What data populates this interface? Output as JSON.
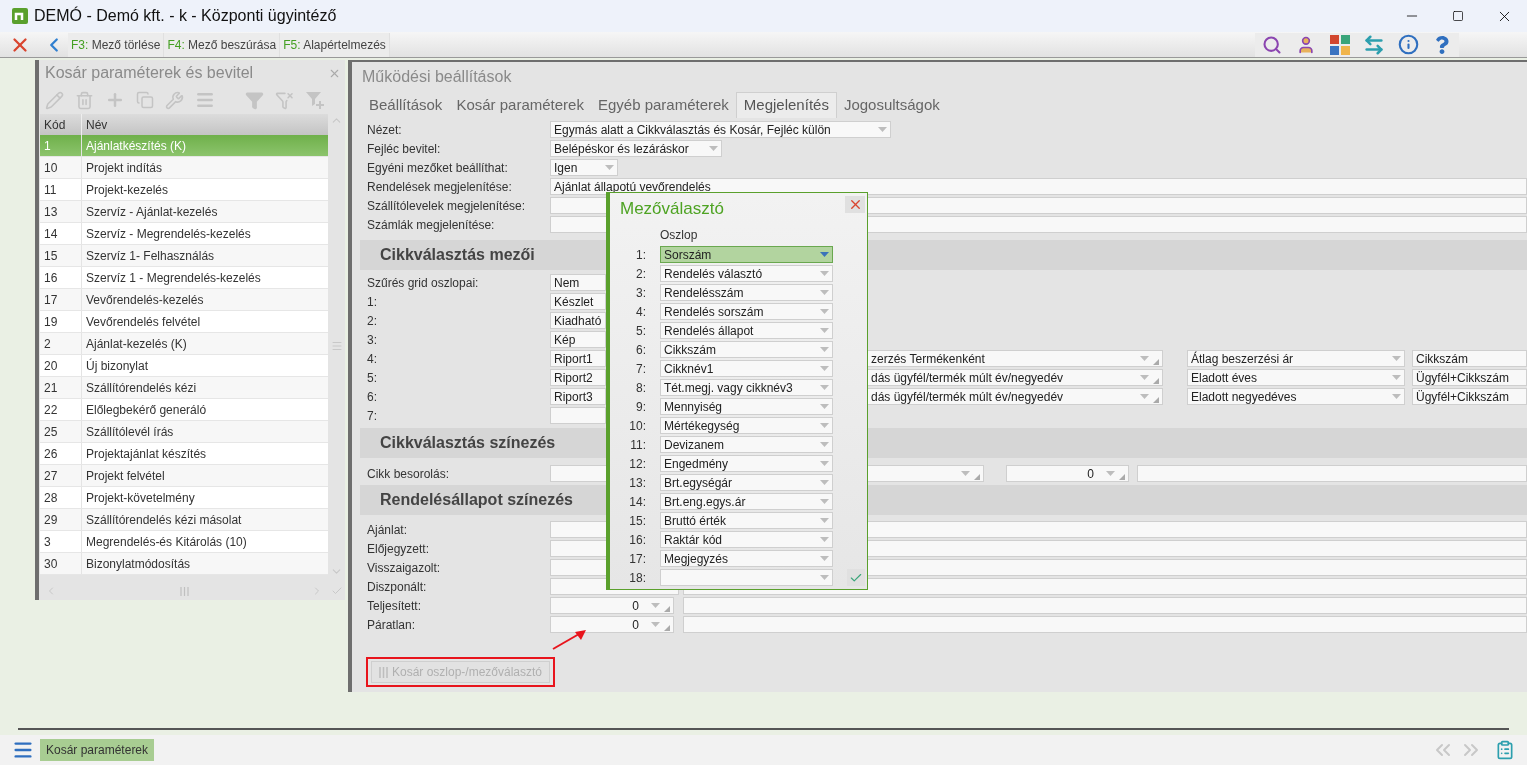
{
  "window": {
    "title": "DEMÓ - Demó kft. - k - Központi ügyintéző"
  },
  "toolbar": {
    "keys": [
      {
        "key": "F3:",
        "label": "Mező törlése"
      },
      {
        "key": "F4:",
        "label": "Mező beszúrása"
      },
      {
        "key": "F5:",
        "label": "Alapértelmezés"
      }
    ]
  },
  "left_panel": {
    "title": "Kosár paraméterek és bevitel",
    "columns": [
      "Kód",
      "Név"
    ],
    "rows": [
      {
        "code": "1",
        "name": "Ajánlatkészítés (K)",
        "selected": true
      },
      {
        "code": "10",
        "name": "Projekt indítás",
        "selected": false
      },
      {
        "code": "11",
        "name": "Projekt-kezelés",
        "selected": false
      },
      {
        "code": "13",
        "name": "Szervíz - Ajánlat-kezelés",
        "selected": false
      },
      {
        "code": "14",
        "name": "Szervíz - Megrendelés-kezelés",
        "selected": false
      },
      {
        "code": "15",
        "name": "Szervíz 1- Felhasználás",
        "selected": false
      },
      {
        "code": "16",
        "name": "Szervíz 1 - Megrendelés-kezelés",
        "selected": false
      },
      {
        "code": "17",
        "name": "Vevőrendelés-kezelés",
        "selected": false
      },
      {
        "code": "19",
        "name": "Vevőrendelés felvétel",
        "selected": false
      },
      {
        "code": "2",
        "name": "Ajánlat-kezelés (K)",
        "selected": false
      },
      {
        "code": "20",
        "name": "Új bizonylat",
        "selected": false
      },
      {
        "code": "21",
        "name": "Szállítórendelés kézi",
        "selected": false
      },
      {
        "code": "22",
        "name": "Előlegbekérő generáló",
        "selected": false
      },
      {
        "code": "25",
        "name": "Szállítólevél írás",
        "selected": false
      },
      {
        "code": "26",
        "name": "Projektajánlat készítés",
        "selected": false
      },
      {
        "code": "27",
        "name": "Projekt felvétel",
        "selected": false
      },
      {
        "code": "28",
        "name": "Projekt-követelmény",
        "selected": false
      },
      {
        "code": "29",
        "name": "Szállítórendelés kézi másolat",
        "selected": false
      },
      {
        "code": "3",
        "name": "Megrendelés-és Kitárolás (10)",
        "selected": false
      },
      {
        "code": "30",
        "name": "Bizonylatmódosítás",
        "selected": false
      }
    ]
  },
  "main": {
    "title": "Működési beállítások",
    "tabs": [
      {
        "label": "Beállítások",
        "selected": false
      },
      {
        "label": "Kosár paraméterek",
        "selected": false
      },
      {
        "label": "Egyéb paraméterek",
        "selected": false
      },
      {
        "label": "Megjelenítés",
        "selected": true
      },
      {
        "label": "Jogosultságok",
        "selected": false
      }
    ],
    "settings": [
      {
        "label": "Nézet:",
        "value": "Egymás alatt a Cikkválasztás és Kosár, Fejléc külön",
        "kind": "select"
      },
      {
        "label": "Fejléc bevitel:",
        "value": "Belépéskor és lezáráskor",
        "kind": "select"
      },
      {
        "label": "Egyéni mezőket beállíthat:",
        "value": "Igen",
        "kind": "select"
      },
      {
        "label": "Rendelések megjelenítése:",
        "value": "Ajánlat állapotú vevőrendelés",
        "kind": "text"
      },
      {
        "label": "Szállítólevelek megjelenítése:",
        "kind": "text"
      },
      {
        "label": "Számlák megjelenítése:",
        "kind": "text"
      }
    ],
    "item_fields": {
      "title": "Cikkválasztás mezői",
      "rows": [
        {
          "label": "Szűrés grid oszlopai:",
          "value": "Nem"
        },
        {
          "label": "1:",
          "value": "Készlet"
        },
        {
          "label": "2:",
          "value": "Kiadható"
        },
        {
          "label": "3:",
          "value": "Kép"
        },
        {
          "label": "4:",
          "value": "Riport1",
          "extra": [
            "zerzés Termékenként",
            "Átlag beszerzési ár",
            "Cikkszám"
          ]
        },
        {
          "label": "5:",
          "value": "Riport2",
          "extra": [
            "dás ügyfél/termék múlt év/negyedév",
            "Eladott éves",
            "Ügyfél+Cikkszám"
          ]
        },
        {
          "label": "6:",
          "value": "Riport3",
          "extra": [
            "dás ügyfél/termék múlt év/negyedév",
            "Eladott negyedéves",
            "Ügyfél+Cikkszám"
          ]
        },
        {
          "label": "7:"
        }
      ]
    },
    "item_coloring": {
      "title": "Cikkválasztás színezés",
      "label": "Cikk besorolás:",
      "value": "0"
    },
    "status_coloring": {
      "title": "Rendelésállapot színezés",
      "rows": [
        {
          "label": "Ajánlat:"
        },
        {
          "label": "Előjegyzett:"
        },
        {
          "label": "Visszaigazolt:"
        },
        {
          "label": "Diszponált:"
        },
        {
          "label": "Teljesített:",
          "value": "0"
        },
        {
          "label": "Páratlan:",
          "value": "0"
        }
      ]
    },
    "button": {
      "label": "Kosár oszlop-/mezőválasztó",
      "disabled": true
    }
  },
  "dialog": {
    "title": "Mezőválasztó",
    "column_header": "Oszlop",
    "rows": [
      {
        "number": "1:",
        "value": "Sorszám",
        "selected": true
      },
      {
        "number": "2:",
        "value": "Rendelés választó",
        "selected": false
      },
      {
        "number": "3:",
        "value": "Rendelésszám",
        "selected": false
      },
      {
        "number": "4:",
        "value": "Rendelés sorszám",
        "selected": false
      },
      {
        "number": "5:",
        "value": "Rendelés állapot",
        "selected": false
      },
      {
        "number": "6:",
        "value": "Cikkszám",
        "selected": false
      },
      {
        "number": "7:",
        "value": "Cikknév1",
        "selected": false
      },
      {
        "number": "8:",
        "value": "Tét.megj. vagy cikknév3",
        "selected": false
      },
      {
        "number": "9:",
        "value": "Mennyiség",
        "selected": false
      },
      {
        "number": "10:",
        "value": "Mértékegység",
        "selected": false
      },
      {
        "number": "11:",
        "value": "Devizanem",
        "selected": false
      },
      {
        "number": "12:",
        "value": "Engedmény",
        "selected": false
      },
      {
        "number": "13:",
        "value": "Brt.egységár",
        "selected": false
      },
      {
        "number": "14:",
        "value": "Brt.eng.egys.ár",
        "selected": false
      },
      {
        "number": "15:",
        "value": "Bruttó érték",
        "selected": false
      },
      {
        "number": "16:",
        "value": "Raktár kód",
        "selected": false
      },
      {
        "number": "17:",
        "value": "Megjegyzés",
        "selected": false
      },
      {
        "number": "18:",
        "selected": false
      }
    ]
  },
  "taskbar": {
    "tabs": [
      {
        "label": "Kosár paraméterek"
      }
    ]
  }
}
